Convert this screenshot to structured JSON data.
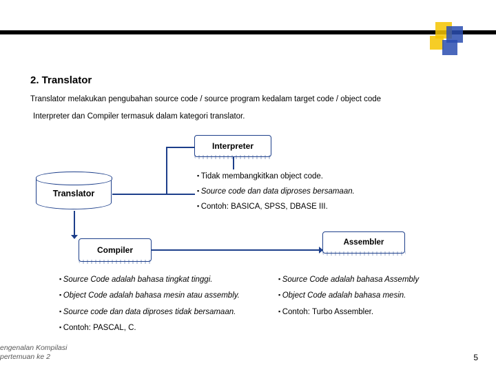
{
  "heading": "2.  Translator",
  "para1": "Translator melakukan pengubahan source code / source program kedalam target code / object code",
  "para2": "Interpreter dan Compiler termasuk dalam kategori translator.",
  "boxes": {
    "interpreter": "Interpreter",
    "translator": "Translator",
    "compiler": "Compiler",
    "assembler": "Assembler"
  },
  "interpreter_bullets": [
    "Tidak membangkitkan object code.",
    "Source code dan data diproses bersamaan.",
    "Contoh: BASICA, SPSS, DBASE III."
  ],
  "compiler_bullets": [
    "Source Code adalah bahasa tingkat tinggi.",
    "Object Code adalah bahasa mesin atau assembly.",
    "Source code dan data diproses tidak bersamaan.",
    "Contoh: PASCAL, C."
  ],
  "assembler_bullets": [
    "Source Code adalah bahasa Assembly",
    "Object Code adalah bahasa mesin.",
    "Contoh: Turbo Assembler."
  ],
  "footer": {
    "line1": "engenalan Kompilasi",
    "line2": "pertemuan ke 2"
  },
  "page_number": "5"
}
